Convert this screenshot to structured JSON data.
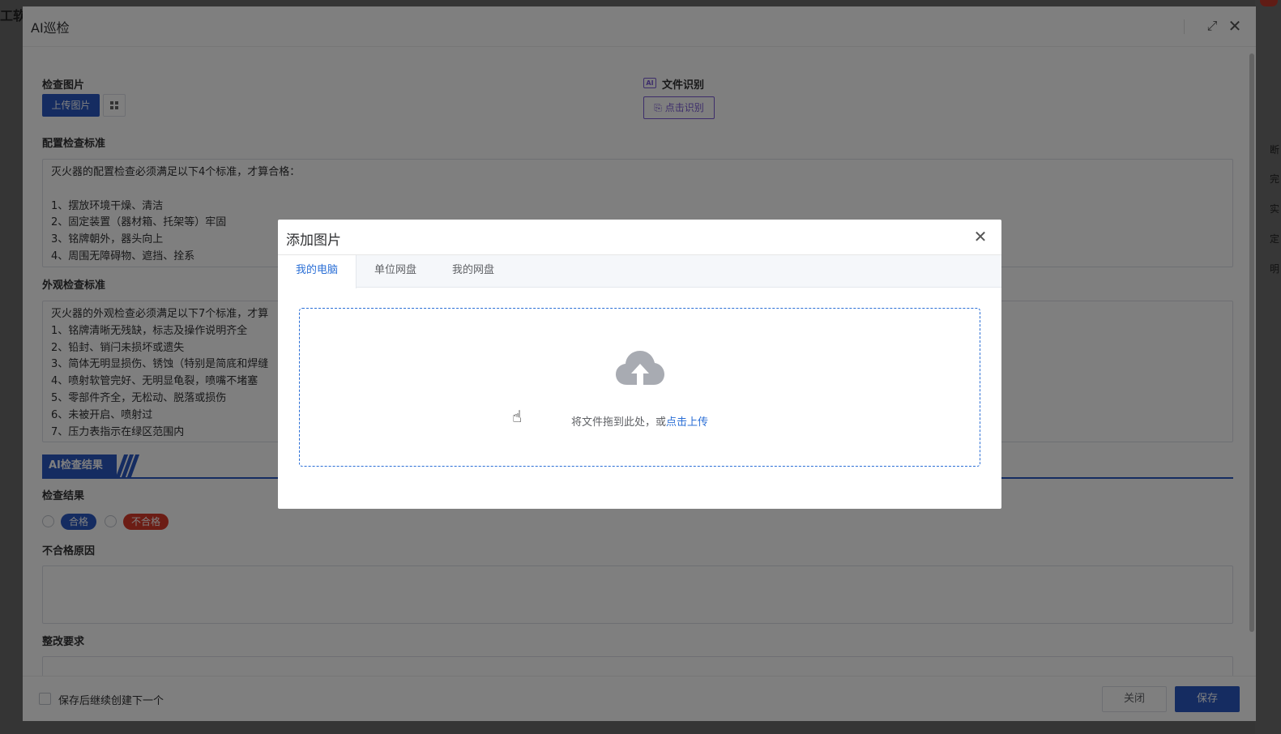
{
  "background": {
    "left_label": "工软",
    "right_items": [
      "断",
      "完",
      "实",
      "定",
      "明"
    ]
  },
  "main_dialog": {
    "title": "AI巡检",
    "check_image": {
      "label": "检查图片",
      "upload_button": "上传图片"
    },
    "file_recognition": {
      "ai_badge": "AI",
      "label": "文件识别",
      "button": "点击识别"
    },
    "config_standard": {
      "label": "配置检查标准",
      "text": "灭火器的配置检查必须满足以下4个标准，才算合格：\n\n1、摆放环境干燥、清洁\n2、固定装置（器材箱、托架等）牢固\n3、铭牌朝外，器头向上\n4、周围无障碍物、遮挡、拴系"
    },
    "appearance_standard": {
      "label": "外观检查标准",
      "text": "灭火器的外观检查必须满足以下7个标准，才算\n1、铭牌清晰无残缺，标志及操作说明齐全\n2、铅封、销闩未损坏或遗失\n3、简体无明显损伤、锈蚀（特别是简底和焊缝\n4、喷射软管完好、无明显龟裂，喷嘴不堵塞\n5、零部件齐全，无松动、脱落或损伤\n6、未被开启、喷射过\n7、压力表指示在绿区范围内"
    },
    "ai_result_section": "AI检查结果",
    "result": {
      "label": "检查结果",
      "pass": "合格",
      "fail": "不合格"
    },
    "fail_reason_label": "不合格原因",
    "rectification_label": "整改要求",
    "footer": {
      "continue_label": "保存后继续创建下一个",
      "close_button": "关闭",
      "save_button": "保存"
    }
  },
  "add_image_dialog": {
    "title": "添加图片",
    "tabs": [
      "我的电脑",
      "单位网盘",
      "我的网盘"
    ],
    "active_tab": 0,
    "drop_text": "将文件拖到此处，或",
    "drop_link": "点击上传"
  },
  "colors": {
    "primary": "#2b59c3",
    "link": "#2b6fd6",
    "danger": "#d93a2b",
    "ai_purple": "#7b5bd6",
    "cloud_gray": "#a8abb2"
  }
}
